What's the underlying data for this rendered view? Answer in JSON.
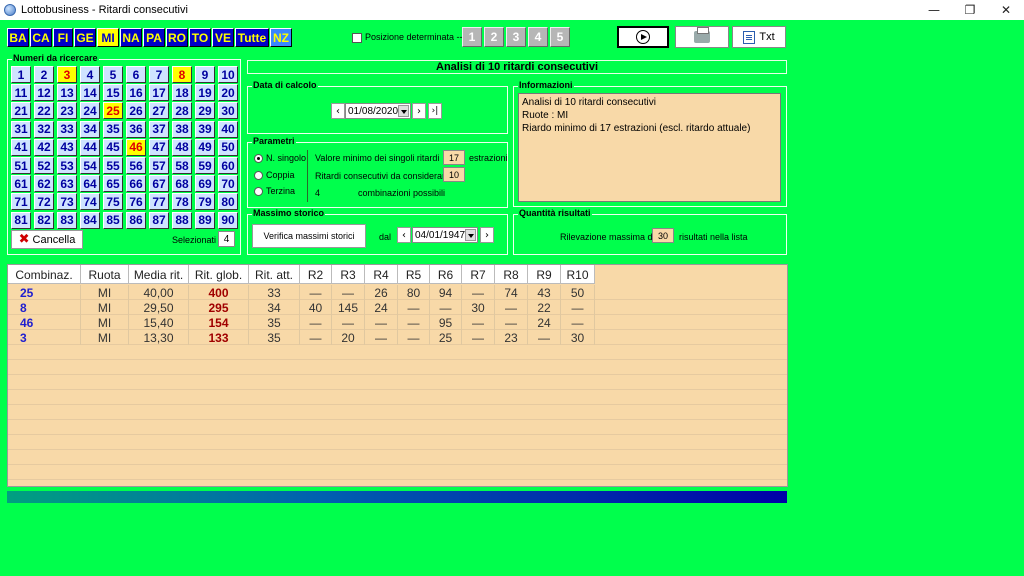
{
  "window": {
    "title": "Lottobusiness - Ritardi consecutivi",
    "minimize": "—",
    "maximize": "❐",
    "close": "✕"
  },
  "wheels": [
    "BA",
    "CA",
    "FI",
    "GE",
    "MI",
    "NA",
    "PA",
    "RO",
    "TO",
    "VE",
    "Tutte",
    "NZ"
  ],
  "selected_wheel": "MI",
  "posizione": {
    "label": "Posizione determinata --->",
    "checked": false,
    "positions": [
      "1",
      "2",
      "3",
      "4",
      "5"
    ]
  },
  "toolbar": {
    "txt_label": "Txt"
  },
  "numeri": {
    "title": "Numeri da ricercare",
    "highlighted": [
      3,
      8,
      25,
      46
    ],
    "clear_label": "Cancella",
    "selected_label": "Selezionati",
    "selected_count": "4"
  },
  "header": {
    "text": "Analisi di 10 ritardi consecutivi"
  },
  "data_calcolo": {
    "title": "Data di calcolo",
    "date": "01/08/2020"
  },
  "parametri": {
    "title": "Parametri",
    "options": [
      "N. singolo",
      "Coppia",
      "Terzina"
    ],
    "selected": "N. singolo",
    "min_value_label": "Valore minimo dei singoli ritardi",
    "min_value": "17",
    "min_value_unit": "estrazioni",
    "consecutive_label": "Ritardi consecutivi da considerare",
    "consecutive": "10",
    "combos_count": "4",
    "combos_label": "combinazioni possibili"
  },
  "informazioni": {
    "title": "Informazioni",
    "lines": [
      "Analisi di 10 ritardi consecutivi",
      "Ruote : MI",
      "Riardo minimo di 17 estrazioni (escl. ritardo attuale)"
    ]
  },
  "massimo_storico": {
    "title": "Massimo storico",
    "button": "Verifica massimi storici",
    "dal_label": "dal",
    "date": "04/01/1947"
  },
  "quantita": {
    "title": "Quantità risultati",
    "label_pre": "Rilevazione massima di",
    "value": "30",
    "label_post": "risultati nella lista"
  },
  "table": {
    "columns": [
      "Combinaz.",
      "Ruota",
      "Media rit.",
      "Rit. glob.",
      "Rit. att.",
      "R2",
      "R3",
      "R4",
      "R5",
      "R6",
      "R7",
      "R8",
      "R9",
      "R10"
    ],
    "rows": [
      [
        "25",
        "MI",
        "40,00",
        "400",
        "33",
        "—",
        "—",
        "26",
        "80",
        "94",
        "—",
        "74",
        "43",
        "50"
      ],
      [
        "8",
        "MI",
        "29,50",
        "295",
        "34",
        "40",
        "145",
        "24",
        "—",
        "—",
        "30",
        "—",
        "22",
        "—"
      ],
      [
        "46",
        "MI",
        "15,40",
        "154",
        "35",
        "—",
        "—",
        "—",
        "—",
        "95",
        "—",
        "—",
        "24",
        "—"
      ],
      [
        "3",
        "MI",
        "13,30",
        "133",
        "35",
        "—",
        "20",
        "—",
        "—",
        "25",
        "—",
        "23",
        "—",
        "30"
      ]
    ]
  },
  "progress": {
    "fraction": 1.0
  },
  "colors": {
    "background": "#00ff4c",
    "wheel_blue": "#0000c8",
    "highlight_yellow": "#ffff00",
    "table_bg": "#f8d9a8"
  }
}
